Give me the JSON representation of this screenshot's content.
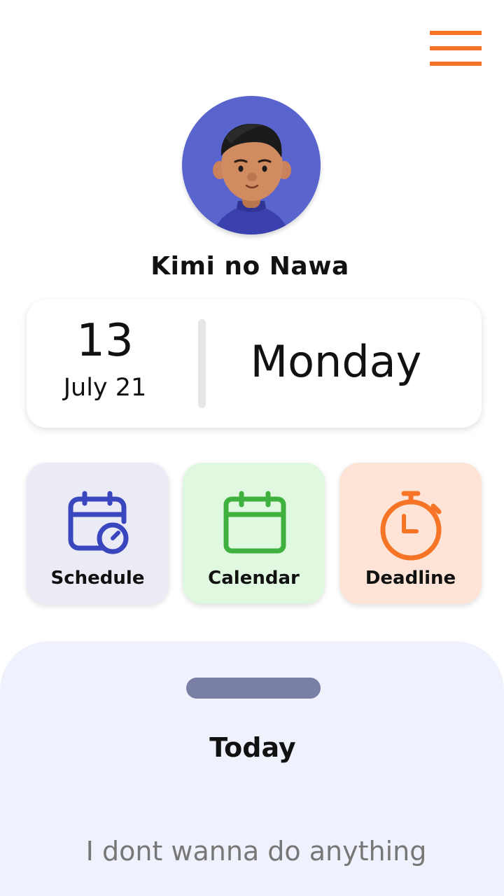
{
  "profile": {
    "name": "Kimi no Nawa",
    "avatar_icon": "person-avatar-icon"
  },
  "menu": {
    "icon": "hamburger-menu-icon",
    "color": "#f57426"
  },
  "date_card": {
    "day": "13",
    "month_year": "July 21",
    "weekday": "Monday"
  },
  "actions": [
    {
      "label": "Schedule",
      "icon": "calendar-clock-icon",
      "color": "#3a46bd",
      "background": "#ebebf6"
    },
    {
      "label": "Calendar",
      "icon": "calendar-icon",
      "color": "#3fb13f",
      "background": "#dff8df"
    },
    {
      "label": "Deadline",
      "icon": "stopwatch-icon",
      "color": "#f57426",
      "background": "#fde4d6"
    }
  ],
  "today_sheet": {
    "title": "Today",
    "empty_text": "I dont wanna do anything",
    "background": "#eff1fd"
  }
}
